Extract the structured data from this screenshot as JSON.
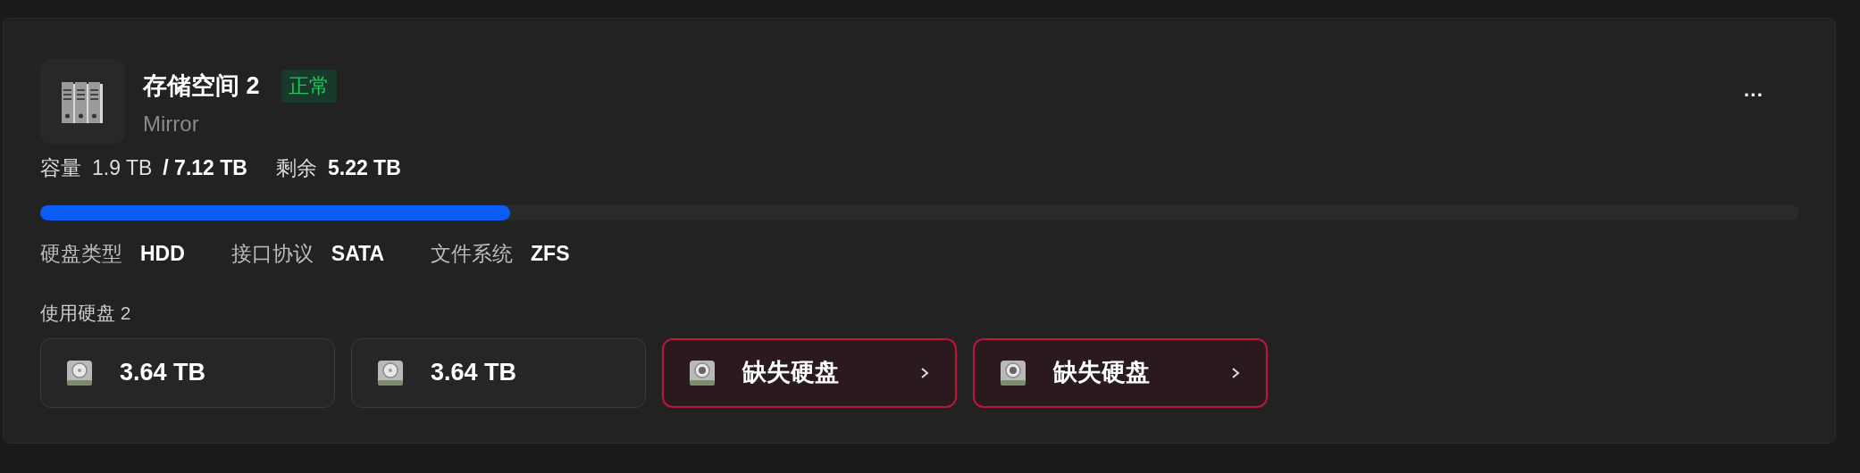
{
  "pool": {
    "title": "存储空间 2",
    "status": {
      "label": "正常",
      "kind": "ok"
    },
    "raid": "Mirror",
    "more": "···",
    "capacity": {
      "label": "容量",
      "used": "1.9 TB",
      "total": "/ 7.12 TB",
      "free_label": "剩余",
      "free": "5.22 TB",
      "level": 0.267
    },
    "specs": [
      {
        "label": "硬盘类型",
        "value": "HDD"
      },
      {
        "label": "接口协议",
        "value": "SATA"
      },
      {
        "label": "文件系统",
        "value": "ZFS"
      }
    ],
    "disks_label": "使用硬盘 2",
    "disks": [
      {
        "kind": "disk",
        "label": "3.64 TB"
      },
      {
        "kind": "disk",
        "label": "3.64 TB"
      },
      {
        "kind": "missing",
        "label": "缺失硬盘"
      },
      {
        "kind": "missing",
        "label": "缺失硬盘"
      }
    ]
  }
}
